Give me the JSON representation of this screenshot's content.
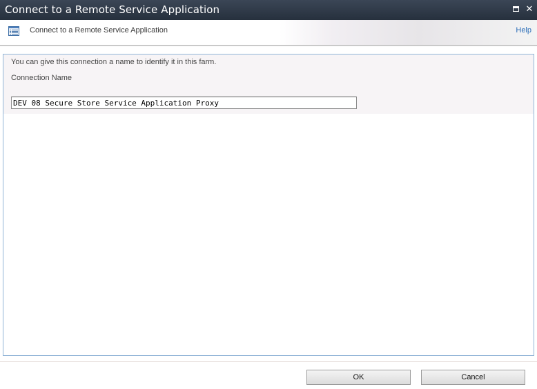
{
  "window": {
    "title": "Connect to a Remote Service Application",
    "controls": {
      "maximize_icon": "maximize-icon",
      "close_label": "✕"
    }
  },
  "header": {
    "icon": "list-page-icon",
    "title": "Connect to a Remote Service Application",
    "help_label": "Help",
    "colors": {
      "link": "#2a6db8"
    }
  },
  "form": {
    "description": "You can give this connection a name to identify it in this farm.",
    "connection_name_label": "Connection Name",
    "connection_name_value": "DEV 08 Secure Store Service Application Proxy"
  },
  "footer": {
    "ok_label": "OK",
    "cancel_label": "Cancel"
  }
}
